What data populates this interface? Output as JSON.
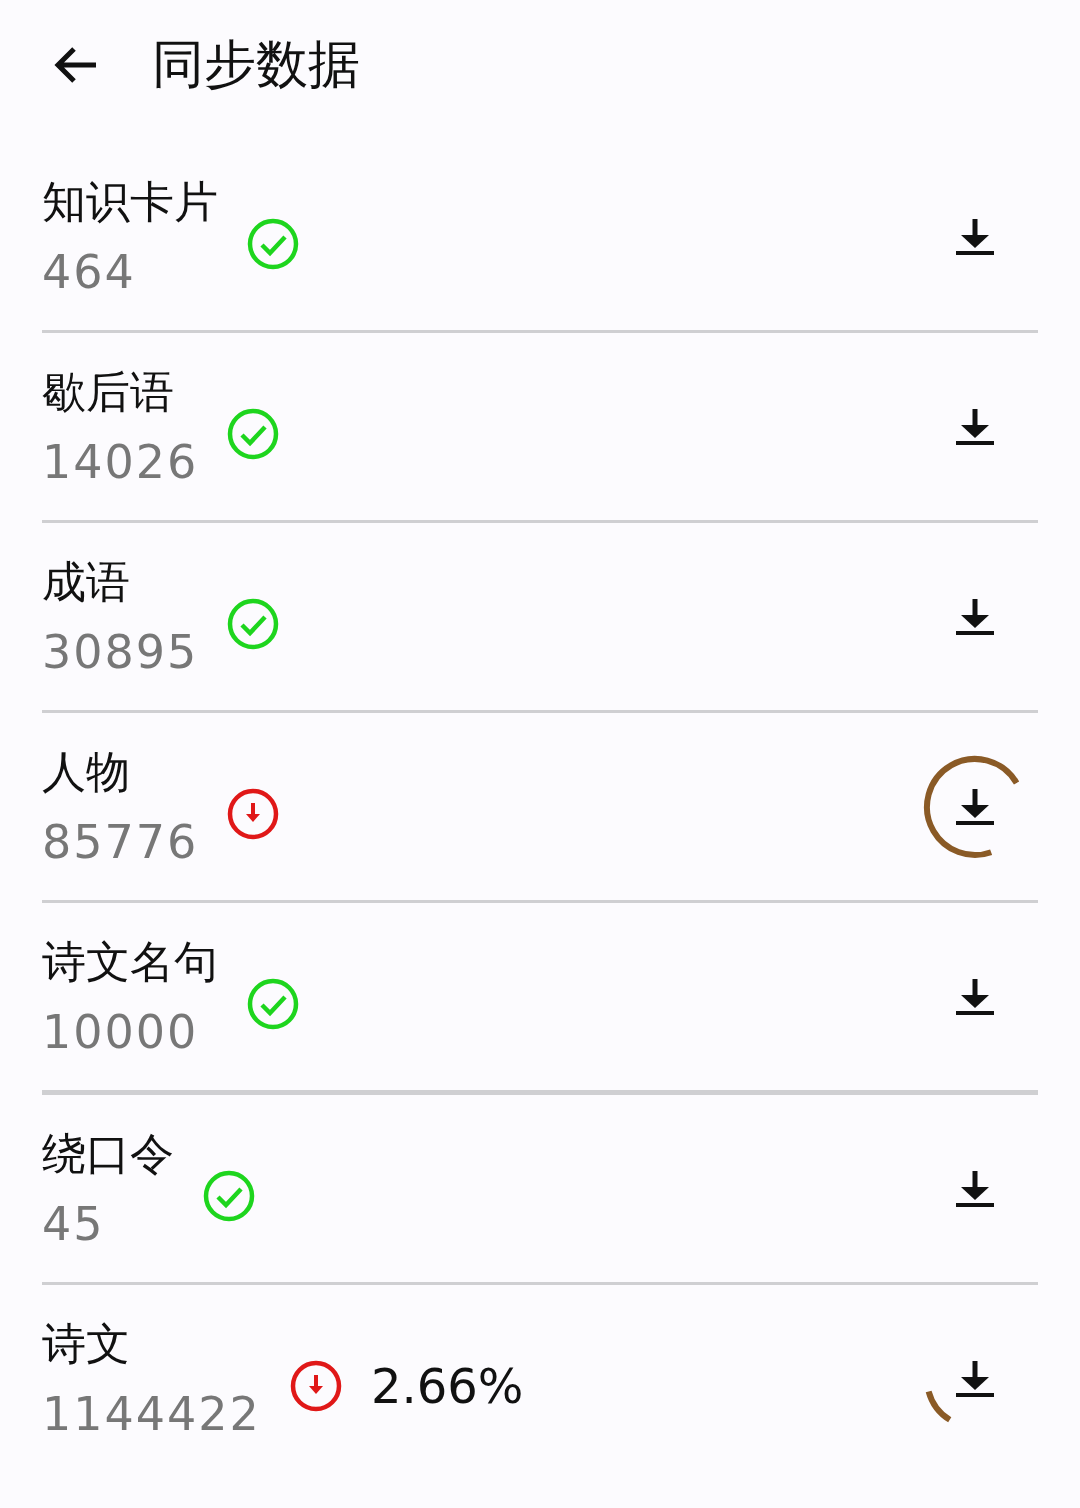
{
  "header": {
    "title": "同步数据"
  },
  "items": [
    {
      "name": "知识卡片",
      "count": "464",
      "kind": "done"
    },
    {
      "name": "歇后语",
      "count": "14026",
      "kind": "done"
    },
    {
      "name": "成语",
      "count": "30895",
      "kind": "done"
    },
    {
      "name": "人物",
      "count": "85776",
      "kind": "pending",
      "level": 0.72
    },
    {
      "name": "诗文名句",
      "count": "10000",
      "kind": "done"
    },
    {
      "name": "绕口令",
      "count": "45",
      "kind": "done"
    },
    {
      "name": "诗文",
      "count": "1144422",
      "kind": "pending",
      "progress": "2.66%",
      "level": 0.12
    }
  ]
}
